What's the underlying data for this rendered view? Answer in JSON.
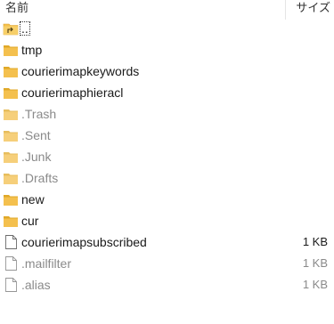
{
  "header": {
    "name_label": "名前",
    "size_label": "サイズ"
  },
  "colors": {
    "folder": "#f4c04e",
    "folder_dark": "#e0a828",
    "hidden_text": "#8a8a8a"
  },
  "items": [
    {
      "name": "..",
      "type": "parent-folder",
      "icon": "folder-up-icon",
      "size": "",
      "hidden": false
    },
    {
      "name": "tmp",
      "type": "folder",
      "icon": "folder-icon",
      "size": "",
      "hidden": false
    },
    {
      "name": "courierimapkeywords",
      "type": "folder",
      "icon": "folder-icon",
      "size": "",
      "hidden": false
    },
    {
      "name": "courierimaphieracl",
      "type": "folder",
      "icon": "folder-icon",
      "size": "",
      "hidden": false
    },
    {
      "name": ".Trash",
      "type": "folder",
      "icon": "folder-icon",
      "size": "",
      "hidden": true
    },
    {
      "name": ".Sent",
      "type": "folder",
      "icon": "folder-icon",
      "size": "",
      "hidden": true
    },
    {
      "name": ".Junk",
      "type": "folder",
      "icon": "folder-icon",
      "size": "",
      "hidden": true
    },
    {
      "name": ".Drafts",
      "type": "folder",
      "icon": "folder-icon",
      "size": "",
      "hidden": true
    },
    {
      "name": "new",
      "type": "folder",
      "icon": "folder-icon",
      "size": "",
      "hidden": false
    },
    {
      "name": "cur",
      "type": "folder",
      "icon": "folder-icon",
      "size": "",
      "hidden": false
    },
    {
      "name": "courierimapsubscribed",
      "type": "file",
      "icon": "file-icon",
      "size": "1 KB",
      "hidden": false
    },
    {
      "name": ".mailfilter",
      "type": "file",
      "icon": "file-icon",
      "size": "1 KB",
      "hidden": true
    },
    {
      "name": ".alias",
      "type": "file",
      "icon": "file-icon",
      "size": "1 KB",
      "hidden": true
    }
  ]
}
